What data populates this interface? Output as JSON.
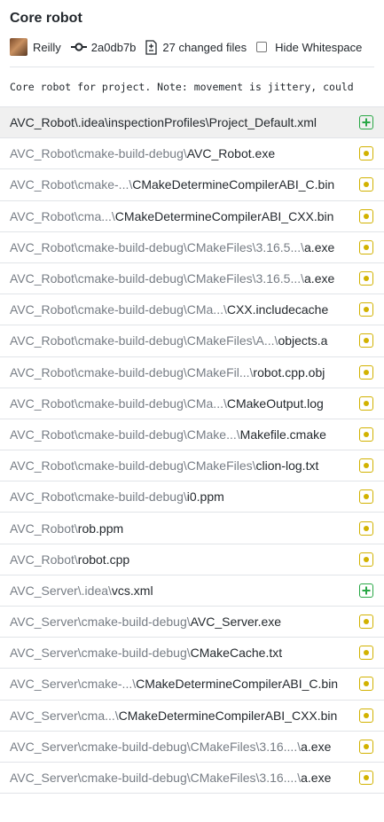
{
  "commit": {
    "title": "Core robot",
    "author": "Reilly",
    "sha": "2a0db7b",
    "changed_files": "27 changed files",
    "hide_whitespace_label": "Hide Whitespace",
    "hide_whitespace_checked": false,
    "message": "Core robot for project. Note: movement is jittery, could"
  },
  "colors": {
    "added": "#28a745",
    "modified": "#d2b200",
    "selected_row": "#f0f0f0"
  },
  "files": [
    {
      "dir": "AVC_Robot\\.idea\\inspectionProfiles\\",
      "name": "Project_Default.xml",
      "status": "added",
      "selected": true
    },
    {
      "dir": "AVC_Robot\\cmake-build-debug\\",
      "name": "AVC_Robot.exe",
      "status": "modified"
    },
    {
      "dir": "AVC_Robot\\cmake-...\\",
      "name": "CMakeDetermineCompilerABI_C.bin",
      "status": "modified"
    },
    {
      "dir": "AVC_Robot\\cma...\\",
      "name": "CMakeDetermineCompilerABI_CXX.bin",
      "status": "modified"
    },
    {
      "dir": "AVC_Robot\\cmake-build-debug\\CMakeFiles\\3.16.5...\\",
      "name": "a.exe",
      "status": "modified"
    },
    {
      "dir": "AVC_Robot\\cmake-build-debug\\CMakeFiles\\3.16.5...\\",
      "name": "a.exe",
      "status": "modified"
    },
    {
      "dir": "AVC_Robot\\cmake-build-debug\\CMa...\\",
      "name": "CXX.includecache",
      "status": "modified"
    },
    {
      "dir": "AVC_Robot\\cmake-build-debug\\CMakeFiles\\A...\\",
      "name": "objects.a",
      "status": "modified"
    },
    {
      "dir": "AVC_Robot\\cmake-build-debug\\CMakeFil...\\",
      "name": "robot.cpp.obj",
      "status": "modified"
    },
    {
      "dir": "AVC_Robot\\cmake-build-debug\\CMa...\\",
      "name": "CMakeOutput.log",
      "status": "modified"
    },
    {
      "dir": "AVC_Robot\\cmake-build-debug\\CMake...\\",
      "name": "Makefile.cmake",
      "status": "modified"
    },
    {
      "dir": "AVC_Robot\\cmake-build-debug\\CMakeFiles\\",
      "name": "clion-log.txt",
      "status": "modified"
    },
    {
      "dir": "AVC_Robot\\cmake-build-debug\\",
      "name": "i0.ppm",
      "status": "modified"
    },
    {
      "dir": "AVC_Robot\\",
      "name": "rob.ppm",
      "status": "modified"
    },
    {
      "dir": "AVC_Robot\\",
      "name": "robot.cpp",
      "status": "modified"
    },
    {
      "dir": "AVC_Server\\.idea\\",
      "name": "vcs.xml",
      "status": "added"
    },
    {
      "dir": "AVC_Server\\cmake-build-debug\\",
      "name": "AVC_Server.exe",
      "status": "modified"
    },
    {
      "dir": "AVC_Server\\cmake-build-debug\\",
      "name": "CMakeCache.txt",
      "status": "modified"
    },
    {
      "dir": "AVC_Server\\cmake-...\\",
      "name": "CMakeDetermineCompilerABI_C.bin",
      "status": "modified"
    },
    {
      "dir": "AVC_Server\\cma...\\",
      "name": "CMakeDetermineCompilerABI_CXX.bin",
      "status": "modified"
    },
    {
      "dir": "AVC_Server\\cmake-build-debug\\CMakeFiles\\3.16....\\",
      "name": "a.exe",
      "status": "modified"
    },
    {
      "dir": "AVC_Server\\cmake-build-debug\\CMakeFiles\\3.16....\\",
      "name": "a.exe",
      "status": "modified"
    }
  ]
}
